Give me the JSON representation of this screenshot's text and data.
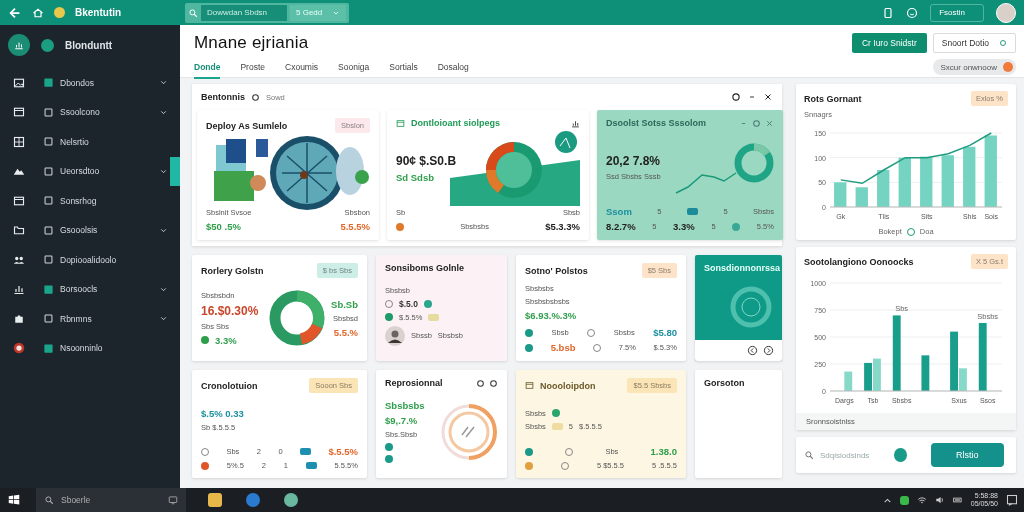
{
  "topbar": {
    "brand": "Bkentutin",
    "search": {
      "value": "Dowwdan Sbdsn"
    },
    "filter": {
      "value": "5 Gedd"
    },
    "account_button": "Fsostin"
  },
  "sidebar": {
    "title": "Blonduntt",
    "items": [
      {
        "label": "Dbondos",
        "expandable": true,
        "selected": false
      },
      {
        "label": "Ssoolcono",
        "expandable": true,
        "selected": false
      },
      {
        "label": "Nelsrtio",
        "expandable": false,
        "selected": false
      },
      {
        "label": "Ueorsdtoo",
        "expandable": true,
        "selected": true
      },
      {
        "label": "Sonsrhog",
        "expandable": false,
        "selected": false
      },
      {
        "label": "Gsooolsis",
        "expandable": true,
        "selected": false
      },
      {
        "label": "Dopiooalidoolo",
        "expandable": false,
        "selected": false
      },
      {
        "label": "Borsoocls",
        "expandable": true,
        "selected": false
      },
      {
        "label": "Rbnmns",
        "expandable": true,
        "selected": false
      },
      {
        "label": "Nsoonninlo",
        "expandable": false,
        "selected": false
      }
    ]
  },
  "header": {
    "title": "Mnane ejriania",
    "tabs": [
      {
        "label": "Donde",
        "selected": true
      },
      {
        "label": "Proste",
        "selected": false
      },
      {
        "label": "Cxoumis",
        "selected": false
      },
      {
        "label": "Sooniga",
        "selected": false
      },
      {
        "label": "Sortials",
        "selected": false
      },
      {
        "label": "Dosalog",
        "selected": false
      }
    ],
    "primary_button": "Cr Iuro Snidstr",
    "secondary_button": "Snoort Dotio",
    "chip": "Sxcur onwnoow"
  },
  "overview": {
    "title": "Bentonnis",
    "subtitle": "Sowd",
    "cards": [
      {
        "title": "Deploy As Sumlelo",
        "badge": {
          "text": "Sbslon",
          "color": "#fde8ec"
        },
        "footer": [
          {
            "parts": [
              {
                "kind": "caption",
                "text": "Sbslnit Svsoe"
              },
              {
                "kind": "caption",
                "text": "Sbsbon"
              }
            ]
          },
          {
            "parts": [
              {
                "kind": "gain",
                "text": "$50 .5%"
              },
              {
                "kind": "loss",
                "text": "5.5.5%"
              }
            ]
          }
        ]
      },
      {
        "title": "Dontloioant siolpegs",
        "rows": [
          {
            "parts": [
              {
                "kind": "metric",
                "text": "90¢ $.S0.B"
              }
            ]
          },
          {
            "parts": [
              {
                "kind": "gain",
                "text": "Sd Sdsb"
              }
            ]
          }
        ],
        "footer": [
          {
            "parts": [
              {
                "kind": "caption",
                "text": "Sb"
              },
              {
                "kind": "caption",
                "text": "Sbsb"
              }
            ]
          },
          {
            "parts": [
              {
                "kind": "dot",
                "color": "#e07a2a"
              },
              {
                "kind": "caption",
                "text": "Sbsbsbs"
              },
              {
                "kind": "value",
                "text": "$5.3.3%"
              }
            ]
          }
        ]
      },
      {
        "title": "Dsoolst Sotss Sssolom",
        "rows": [
          {
            "parts": [
              {
                "kind": "metric",
                "text": "20,2 7.8%"
              }
            ]
          },
          {
            "parts": [
              {
                "kind": "caption",
                "text": "Ssd Sbsbs Sssb"
              }
            ]
          }
        ],
        "footer": [
          {
            "parts": [
              {
                "kind": "accent",
                "text": "Ssom"
              },
              {
                "kind": "caption",
                "text": "5"
              },
              {
                "kind": "chip",
                "color": "#1d8c9a"
              },
              {
                "kind": "caption",
                "text": "5"
              },
              {
                "kind": "caption",
                "text": "Sbsbs"
              }
            ]
          },
          {
            "parts": [
              {
                "kind": "value",
                "text": "8.2.7%"
              },
              {
                "kind": "caption",
                "text": "5"
              },
              {
                "kind": "value",
                "text": "3.3%"
              },
              {
                "kind": "caption",
                "text": "5"
              },
              {
                "kind": "dot",
                "color": "#3aa894"
              },
              {
                "kind": "caption",
                "text": "5.5%"
              }
            ]
          }
        ]
      }
    ]
  },
  "cards": [
    {
      "title": "Rorlery Golstn",
      "badge": {
        "text": "$ bs Sbs",
        "color": "#cdeee6"
      },
      "rows": [
        {
          "parts": [
            {
              "kind": "caption",
              "text": "Sbsbsbdn"
            }
          ]
        },
        {
          "parts": [
            {
              "kind": "alert",
              "text": "16.$0.30%"
            }
          ]
        },
        {
          "parts": [
            {
              "kind": "caption",
              "text": "Sbs Sbs"
            }
          ]
        },
        {
          "parts": [
            {
              "kind": "dot",
              "color": "#2e9e4a"
            },
            {
              "kind": "gain",
              "text": "3.3%"
            }
          ]
        }
      ],
      "side": [
        {
          "parts": [
            {
              "kind": "gain",
              "text": "Sb.Sb"
            }
          ]
        },
        {
          "parts": [
            {
              "kind": "caption",
              "text": "Sbsbsd"
            }
          ]
        },
        {
          "parts": [
            {
              "kind": "loss",
              "text": "5.5.%"
            }
          ]
        }
      ]
    },
    {
      "title": "Sonsiboms Golnle",
      "rows": [
        {
          "parts": [
            {
              "kind": "caption",
              "text": "Sbsbsb"
            }
          ]
        },
        {
          "parts": [
            {
              "kind": "ring"
            },
            {
              "kind": "label",
              "text": "$.5.0"
            },
            {
              "kind": "dot",
              "color": "#2aa58e"
            }
          ]
        },
        {
          "parts": [
            {
              "kind": "dot",
              "color": "#1f9a6a"
            },
            {
              "kind": "caption",
              "text": "$.5.5%"
            },
            {
              "kind": "chip",
              "color": "#e6dca0"
            }
          ]
        },
        {
          "parts": [
            {
              "kind": "avatar"
            },
            {
              "kind": "caption",
              "text": "Sbssb"
            },
            {
              "kind": "caption",
              "text": "Sbsbsb"
            }
          ]
        }
      ]
    },
    {
      "title": "Sotno' Polstos",
      "badge": {
        "text": "$5 Sbs",
        "color": "#fde3c8"
      },
      "rows": [
        {
          "parts": [
            {
              "kind": "caption",
              "text": "Sbsbsbs"
            }
          ]
        },
        {
          "parts": [
            {
              "kind": "caption",
              "text": "Sbsbsbsbsbs"
            }
          ]
        },
        {
          "parts": [
            {
              "kind": "gain",
              "text": "$6.93.%.3%"
            }
          ]
        }
      ],
      "footer": [
        {
          "parts": [
            {
              "kind": "dot",
              "color": "#1a9a88"
            },
            {
              "kind": "caption",
              "text": "Sbsb"
            },
            {
              "kind": "ring"
            },
            {
              "kind": "caption",
              "text": "Sbsbs"
            },
            {
              "kind": "accent",
              "text": "$5.80"
            }
          ]
        },
        {
          "parts": [
            {
              "kind": "dot",
              "color": "#1a9a88"
            },
            {
              "kind": "loss",
              "text": "5.bsb"
            },
            {
              "kind": "ring"
            },
            {
              "kind": "caption",
              "text": "7.5%"
            },
            {
              "kind": "caption",
              "text": "$.5.3%"
            }
          ]
        }
      ]
    },
    {
      "title": "Sonsdionnonrssa"
    },
    {
      "title": "Cronolotuion",
      "badge": {
        "text": "Sooon Sbs",
        "color": "#fbe4b5"
      },
      "rows": [
        {
          "parts": [
            {
              "kind": "accent",
              "text": "$.5% 0.33"
            }
          ]
        },
        {
          "parts": [
            {
              "kind": "caption",
              "text": "Sb $.5.5.5"
            }
          ]
        }
      ],
      "footer": [
        {
          "parts": [
            {
              "kind": "ring"
            },
            {
              "kind": "caption",
              "text": "Sbs"
            },
            {
              "kind": "caption",
              "text": "2"
            },
            {
              "kind": "caption",
              "text": "0"
            },
            {
              "kind": "chip",
              "color": "#1d8fb0"
            },
            {
              "kind": "loss",
              "text": "$.5.5%"
            }
          ]
        },
        {
          "parts": [
            {
              "kind": "dot",
              "color": "#e0562a"
            },
            {
              "kind": "caption",
              "text": "5%.5"
            },
            {
              "kind": "caption",
              "text": "2"
            },
            {
              "kind": "caption",
              "text": "1"
            },
            {
              "kind": "chip",
              "color": "#1d8fb0"
            },
            {
              "kind": "caption",
              "text": "5.5.5%"
            }
          ]
        }
      ]
    },
    {
      "title": "Reprosionnal",
      "rows": [
        {
          "parts": [
            {
              "kind": "gain",
              "text": "Sbsbsbs"
            }
          ]
        },
        {
          "parts": [
            {
              "kind": "gain",
              "text": "$9,.7.%"
            }
          ]
        },
        {
          "parts": [
            {
              "kind": "caption",
              "text": "Sbs.Sbsb"
            }
          ]
        },
        {
          "parts": [
            {
              "kind": "dot",
              "color": "#1a9a88"
            }
          ]
        },
        {
          "parts": [
            {
              "kind": "dot",
              "color": "#1a9a88"
            }
          ]
        }
      ]
    },
    {
      "title": "Noooloipdon",
      "badge": {
        "text": "$5.5 Sbsbs",
        "color": "#fbe4b5"
      },
      "rows": [
        {
          "parts": [
            {
              "kind": "caption",
              "text": "Sbsbs"
            },
            {
              "kind": "dot",
              "color": "#2aa56e"
            }
          ]
        },
        {
          "parts": [
            {
              "kind": "caption",
              "text": "Sbsbs"
            },
            {
              "kind": "chip",
              "color": "#f0dca0"
            },
            {
              "kind": "caption",
              "text": "5"
            },
            {
              "kind": "caption",
              "text": "$.5.5.5"
            }
          ]
        }
      ],
      "footer": [
        {
          "parts": [
            {
              "kind": "dot",
              "color": "#1a9a88"
            },
            {
              "kind": "ring"
            },
            {
              "kind": "caption",
              "text": "Sbs"
            },
            {
              "kind": "gain",
              "text": "1.38.0"
            }
          ]
        },
        {
          "parts": [
            {
              "kind": "dot",
              "color": "#e0a040"
            },
            {
              "kind": "ring"
            },
            {
              "kind": "caption",
              "text": "5 $5.5.5"
            },
            {
              "kind": "caption",
              "text": "5 .5.5.5"
            }
          ]
        }
      ]
    },
    {
      "title": "Gorsoton"
    }
  ],
  "chart_cards": [
    {
      "title": "Rots Gornant",
      "badge": {
        "text": "Exlos %",
        "color": "#fde3c8"
      },
      "subtitle": "Snnagrs",
      "chart_data": {
        "type": "bar",
        "categories": [
          "Gk",
          null,
          "Tlis",
          null,
          "Sits",
          null,
          "Shis",
          "Sois"
        ],
        "ylim": [
          0,
          150
        ],
        "yticks": [
          0,
          50,
          100,
          150
        ],
        "grid": true,
        "series": [
          {
            "name": "Bokept",
            "type": "bar",
            "color": "#74d3c1",
            "values": [
              50,
              40,
              75,
              100,
              102,
              105,
              122,
              145
            ]
          },
          {
            "name": "Doa",
            "type": "line",
            "color": "#1f9c7f",
            "values": [
              55,
              48,
              75,
              100,
              100,
              108,
              125,
              150
            ]
          }
        ]
      }
    },
    {
      "title": "Sootolangiono Oonoocks",
      "badge": {
        "text": "X 5 Gs.t",
        "color": "#fde3c8"
      },
      "footnote": "Sronnsoistnlss",
      "chart_data": {
        "type": "bar",
        "categories": [
          "Dargs",
          "Tsb",
          "Sbsbs",
          null,
          "Sxus",
          "Ssos"
        ],
        "ylim": [
          0,
          1000
        ],
        "yticks": [
          0,
          250,
          500,
          750,
          1000
        ],
        "grid": true,
        "series": [
          {
            "type": "bar",
            "color": "#1a9e8c",
            "values": [
              null,
              260,
              700,
              330,
              550,
              630
            ]
          },
          {
            "type": "bar",
            "color": "#86d8c8",
            "values": [
              180,
              300,
              null,
              null,
              210,
              null
            ]
          }
        ],
        "annotations": [
          "Sbs",
          "Sbsbs"
        ]
      }
    }
  ],
  "bottom_bar": {
    "search": {
      "placeholder": "Sdqisiodsinds"
    },
    "button": "Rlstio"
  },
  "taskbar": {
    "search": {
      "placeholder": "Sboerle"
    },
    "time": "5:58:88",
    "date": "05/05/50"
  }
}
